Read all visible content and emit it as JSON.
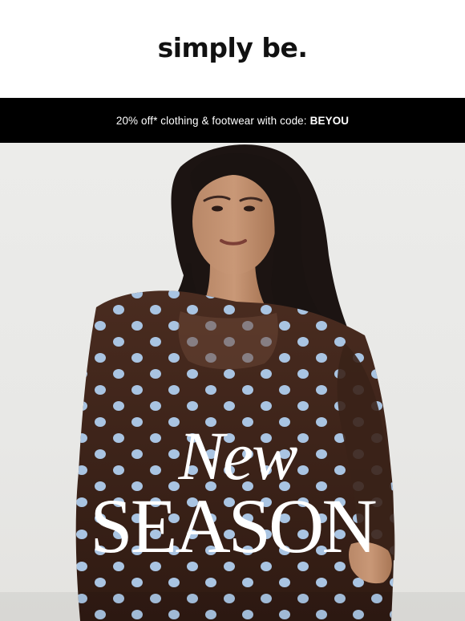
{
  "header": {
    "logo_text": "simply be."
  },
  "promo": {
    "text": "20% off* clothing & footwear with code:",
    "code": "BEYOU"
  },
  "hero": {
    "image_icon": "model-photo-image",
    "headline_line1": "New",
    "headline_line2": "SEASON"
  },
  "colors": {
    "promo_background": "#000000",
    "promo_text": "#ffffff",
    "hero_background": "#e9e9e7",
    "headline_text": "#ffffff",
    "top_fabric": "#3a2218",
    "dot": "#a9c4e2"
  }
}
